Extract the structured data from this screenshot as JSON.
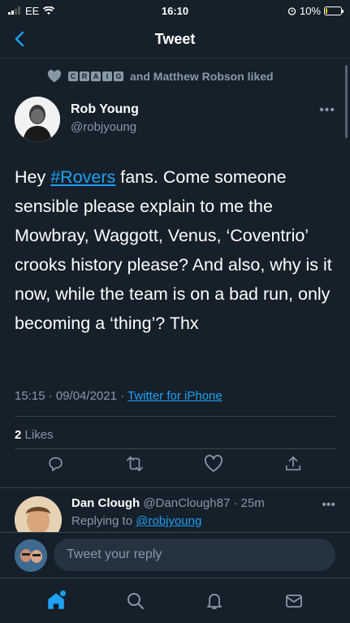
{
  "status_bar": {
    "carrier": "EE",
    "time": "16:10",
    "battery": "10%",
    "battery_level": 0.1
  },
  "header": {
    "title": "Tweet"
  },
  "social_context": {
    "craig_letters": [
      "C",
      "R",
      "A",
      "I",
      "G"
    ],
    "text": "and Matthew Robson liked"
  },
  "tweet": {
    "author_name": "Rob Young",
    "author_handle": "@robjyoung",
    "text_before_hashtag": "Hey ",
    "hashtag": "#Rovers",
    "text_after_hashtag": " fans. Come someone sensible please explain to me the Mowbray, Waggott, Venus, ‘Coventrio’ crooks history please? And also, why is it now, while the team is on a bad run, only becoming a ‘thing’? Thx",
    "timestamp": "15:15 · 09/04/2021 · ",
    "source": "Twitter for iPhone",
    "likes_count": "2",
    "likes_label": "Likes"
  },
  "reply": {
    "author_name": "Dan Clough",
    "author_handle_time": "@DanClough87 · 25m",
    "replying_prefix": "Replying to ",
    "replying_handle": "@robjyoung"
  },
  "compose": {
    "placeholder": "Tweet your reply"
  },
  "colors": {
    "background": "#15202b",
    "accent": "#1da1f2",
    "secondary_text": "#8899a6",
    "divider": "#38444d"
  },
  "icons": {
    "nav": [
      "home-icon",
      "search-icon",
      "notifications-icon",
      "messages-icon"
    ],
    "actions": [
      "reply-icon",
      "retweet-icon",
      "like-icon",
      "share-icon"
    ]
  }
}
